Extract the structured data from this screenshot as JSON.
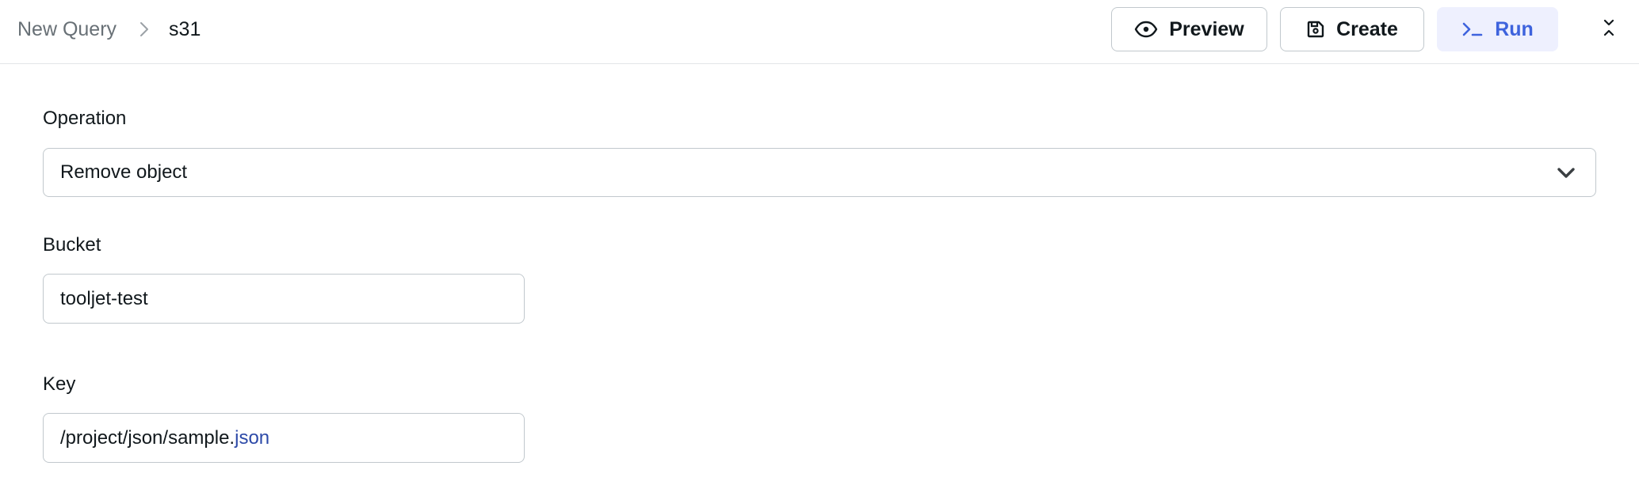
{
  "header": {
    "breadcrumb": {
      "root": "New Query",
      "current": "s31"
    },
    "buttons": {
      "preview": "Preview",
      "create": "Create",
      "run": "Run"
    }
  },
  "form": {
    "operation": {
      "label": "Operation",
      "value": "Remove object"
    },
    "bucket": {
      "label": "Bucket",
      "value": "tooljet-test"
    },
    "key": {
      "label": "Key",
      "value_path": "/project/json/sample.",
      "value_ext": "json"
    }
  },
  "colors": {
    "accent": "#3e63dd",
    "accent_bg": "#eef0fe",
    "border": "#c1c8cd",
    "muted_text": "#687076"
  }
}
